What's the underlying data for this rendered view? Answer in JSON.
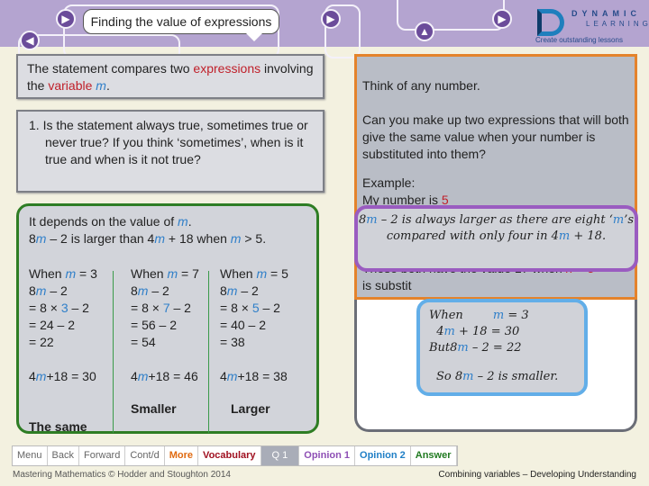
{
  "header": {
    "title": "Finding the value of expressions",
    "logo": {
      "line1": "DYNAMIC",
      "line2": "LEARNING",
      "tagline": "Create outstanding lessons"
    }
  },
  "left": {
    "statement": [
      {
        "t": "The statement compares two "
      },
      {
        "t": "expressions",
        "c": "r"
      },
      {
        "t": " involving the "
      },
      {
        "t": "variable",
        "c": "r"
      },
      {
        "t": " "
      },
      {
        "t": "m",
        "c": "m"
      },
      {
        "t": "."
      }
    ],
    "question": "1.  Is the statement always true, sometimes true or never true? If you think ‘sometimes’, when is it true and when is it not true?",
    "answer": {
      "line1": [
        {
          "t": "It depends on the value of "
        },
        {
          "t": "m",
          "c": "m"
        },
        {
          "t": "."
        }
      ],
      "line2": [
        {
          "t": "8"
        },
        {
          "t": "m",
          "c": "m"
        },
        {
          "t": " – 2 is larger than 4"
        },
        {
          "t": "m",
          "c": "m"
        },
        {
          "t": " + 18 when "
        },
        {
          "t": "m",
          "c": "m"
        },
        {
          "t": " > 5."
        }
      ],
      "columns": [
        {
          "v": "3",
          "a": "= 24 – 2",
          "b": "= 22",
          "c": "+18 = 30",
          "verdict": "The same"
        },
        {
          "v": "7",
          "a": "= 56 – 2",
          "b": "= 54",
          "c": "+18 = 46",
          "verdict": "Smaller"
        },
        {
          "v": "5",
          "a": "= 40 – 2",
          "b": "= 38",
          "c": "+18 = 38",
          "verdict": "Larger"
        }
      ]
    }
  },
  "right": {
    "p1": "Think of any number.",
    "p2": "Can you make up two expressions that will both give the same value when your number is substituted into them?",
    "example": "Example:",
    "mynumber": "My number is ",
    "five": "5",
    "p4a": "These both have the value 17 when ",
    "n": "n",
    "p4b": " = ",
    "p4c": "5",
    "p5": "is substit"
  },
  "opinion1": [
    {
      "t": "8"
    },
    {
      "t": "m",
      "c": "b3"
    },
    {
      "t": " – 2 is always larger as there are eight ‘"
    },
    {
      "t": "m",
      "c": "b3"
    },
    {
      "t": "’s compared with only four in 4"
    },
    {
      "t": "m",
      "c": "b3"
    },
    {
      "t": " + 18."
    }
  ],
  "opinion2": {
    "l1": [
      {
        "t": "When        "
      },
      {
        "t": "m",
        "c": "b3"
      },
      {
        "t": " = 3"
      }
    ],
    "l2": [
      {
        "t": "  4"
      },
      {
        "t": "m",
        "c": "b3"
      },
      {
        "t": " + 18 = 30"
      }
    ],
    "l3": [
      {
        "t": "But8"
      },
      {
        "t": "m",
        "c": "b3"
      },
      {
        "t": " – 2 = 22"
      }
    ],
    "l4": [
      {
        "t": "So 8"
      },
      {
        "t": "m",
        "c": "b3"
      },
      {
        "t": " – 2 is smaller."
      }
    ]
  },
  "toolbar": [
    {
      "label": "Menu",
      "color": "#666"
    },
    {
      "label": "Back",
      "color": "#666"
    },
    {
      "label": "Forward",
      "color": "#666"
    },
    {
      "label": "Cont/d",
      "color": "#666"
    },
    {
      "label": "More",
      "color": "#e06a10"
    },
    {
      "label": "Vocabulary",
      "color": "#a01020"
    },
    {
      "label": "Q 1",
      "color": "#ffffff"
    },
    {
      "label": "Opinion 1",
      "color": "#8e4fb5"
    },
    {
      "label": "Opinion 2",
      "color": "#1f7fc6"
    },
    {
      "label": "Answer",
      "color": "#207a20"
    }
  ],
  "footer": {
    "left": "Mastering Mathematics © Hodder and Stoughton 2014",
    "right": "Combining variables – Developing Understanding"
  }
}
